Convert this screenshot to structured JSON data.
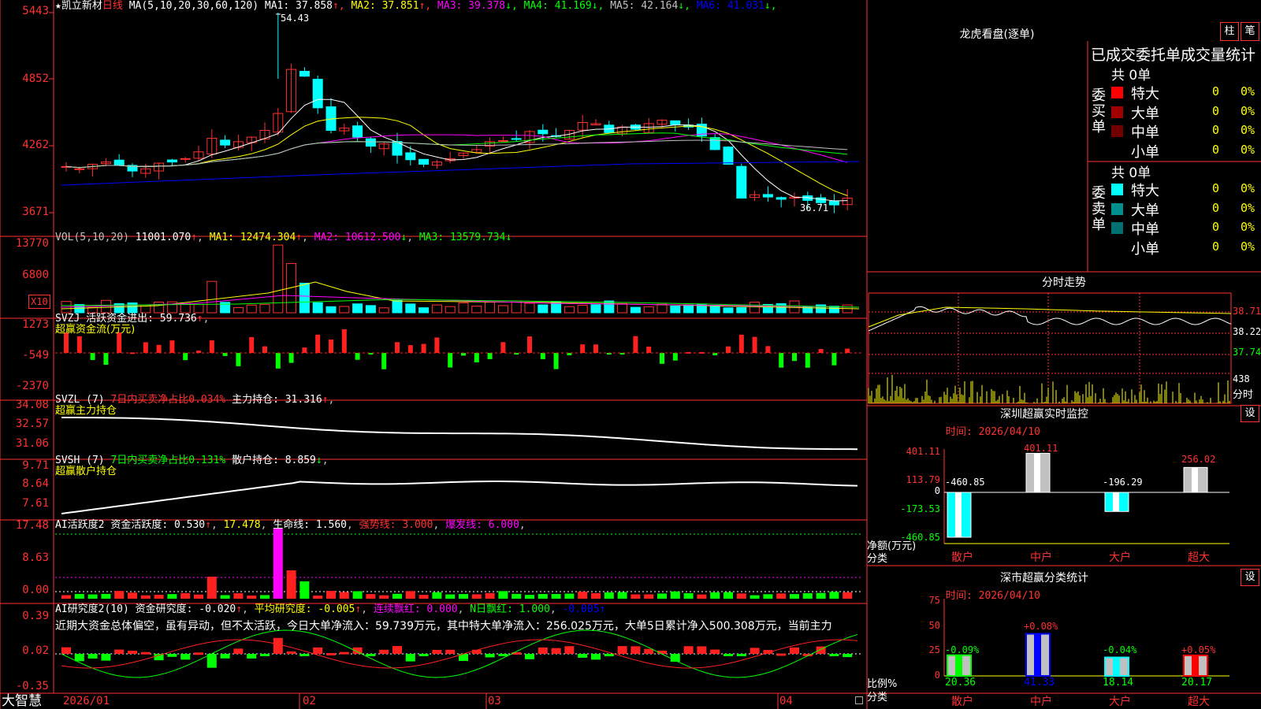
{
  "header": {
    "star": "★",
    "stock_name": "凯立新材",
    "period": "日线",
    "ma_label": "MA(5,10,20,30,60,120)",
    "ma_items": [
      {
        "label": "MA1:",
        "value": "37.858",
        "arrow": "↑",
        "color": "#ffffff"
      },
      {
        "label": "MA2:",
        "value": "37.851",
        "arrow": "↑",
        "color": "#ffff00"
      },
      {
        "label": "MA3:",
        "value": "39.378",
        "arrow": "↓",
        "color": "#ff00ff"
      },
      {
        "label": "MA4:",
        "value": "41.169",
        "arrow": "↓",
        "color": "#00ff00"
      },
      {
        "label": "MA5:",
        "value": "42.164",
        "arrow": "↓",
        "color": "#c0c0c0"
      },
      {
        "label": "MA6:",
        "value": "41.031",
        "arrow": "↓",
        "color": "#0000ff"
      }
    ],
    "high_mark": "54.43",
    "low_mark": "36.71"
  },
  "price_axis": [
    "5443",
    "4852",
    "4262",
    "3671"
  ],
  "vol": {
    "label": "VOL(5,10,20)",
    "value": "11001.070",
    "ma1": "12474.304",
    "ma2": "10612.500",
    "ma3": "13579.734",
    "axis": [
      "13770",
      "6800"
    ],
    "scale": "X10"
  },
  "svzj": {
    "label": "SVZJ",
    "title": "活跃资金进出:",
    "value": "59.736",
    "subtitle": "超赢资金流(万元)",
    "axis": [
      "1273",
      "-549",
      "-2370"
    ]
  },
  "svzl": {
    "label": "SVZL (7)",
    "ratio": "7日内买卖净占比0.034%",
    "title": "主力持仓:",
    "value": "31.316",
    "subtitle": "超赢主力持仓",
    "axis": [
      "34.08",
      "32.57",
      "31.06"
    ]
  },
  "svsh": {
    "label": "SVSH (7)",
    "ratio": "7日内买卖净占比0.131%",
    "title": "散户持仓:",
    "value": "8.859",
    "subtitle": "超赢散户持仓",
    "axis": [
      "9.71",
      "8.64",
      "7.61"
    ]
  },
  "ai1": {
    "label": "AI活跃度2",
    "title": "资金活跃度:",
    "value": "0.530",
    "v2": "17.478",
    "life": "生命线:",
    "life_v": "1.560",
    "strong": "强势线: 3.000",
    "burst": "爆发线: 6.000",
    "axis": [
      "17.48",
      "8.63",
      "0.00"
    ]
  },
  "ai2": {
    "label": "AI研究度2(10)",
    "title": "资金研究度:",
    "value": "-0.020",
    "avg": "平均研究度:",
    "avg_v": "-0.005",
    "c1": "连续飘红: 0.000",
    "c2": "N日飘红: 1.000",
    "c3": "-0.005",
    "comment": "近期大资金总体偏空，虽有异动，但不太活跃，今日大单净流入：59.739万元，其中特大单净流入：256.025万元，大单5日累计净入500.308万元，当前主力",
    "axis": [
      "0.39",
      "0.02",
      "-0.35"
    ]
  },
  "bottom": {
    "brand": "大智慧",
    "dates": [
      "2026/01",
      "02",
      "03",
      "04"
    ]
  },
  "right": {
    "dragon_title": "龙虎看盘(逐单)",
    "btn_pillar": "柱",
    "btn_order": "笔",
    "stat_title": "已成交委托单成交量统计",
    "buy_side": "委买单",
    "sell_side": "委卖单",
    "buy_total": "共 0单",
    "sell_total": "共 0单",
    "buy_rows": [
      {
        "name": "特大",
        "color": "#ff0000",
        "n": "0",
        "p": "0%"
      },
      {
        "name": "大单",
        "color": "#a00000",
        "n": "0",
        "p": "0%"
      },
      {
        "name": "中单",
        "color": "#700000",
        "n": "0",
        "p": "0%"
      },
      {
        "name": "小单",
        "color": "#000000",
        "n": "0",
        "p": "0%"
      }
    ],
    "sell_rows": [
      {
        "name": "特大",
        "color": "#00ffff",
        "n": "0",
        "p": "0%"
      },
      {
        "name": "大单",
        "color": "#009090",
        "n": "0",
        "p": "0%"
      },
      {
        "name": "中单",
        "color": "#007070",
        "n": "0",
        "p": "0%"
      },
      {
        "name": "小单",
        "color": "#000000",
        "n": "0",
        "p": "0%"
      }
    ],
    "intraday_title": "分时走势",
    "intraday_axis": [
      "38.71",
      "38.22",
      "37.74"
    ],
    "intraday_vol": "438",
    "intraday_unit": "分时",
    "monitor_title": "深圳超赢实时监控",
    "set_label": "设",
    "monitor_time": "时间: 2026/04/10",
    "monitor_axis": [
      "401.11",
      "113.79",
      "0",
      "-173.53",
      "-460.85"
    ],
    "monitor_unit": "净额(万元)",
    "monitor_cat_label": "分类",
    "monitor_cats": [
      "散户",
      "中户",
      "大户",
      "超大"
    ],
    "monitor_values": [
      "-460.85",
      "401.11",
      "-196.29",
      "256.02"
    ],
    "class_title": "深市超赢分类统计",
    "class_time": "时间: 2026/04/10",
    "class_axis": [
      "75",
      "50",
      "25",
      "0"
    ],
    "class_unit": "比例%",
    "class_cat_label": "分类",
    "class_changes": [
      "-0.09%",
      "+0.08%",
      "-0.04%",
      "+0.05%"
    ],
    "class_values": [
      "20.36",
      "41.33",
      "18.14",
      "20.17"
    ],
    "class_cats": [
      "散户",
      "中户",
      "大户",
      "超大"
    ]
  }
}
